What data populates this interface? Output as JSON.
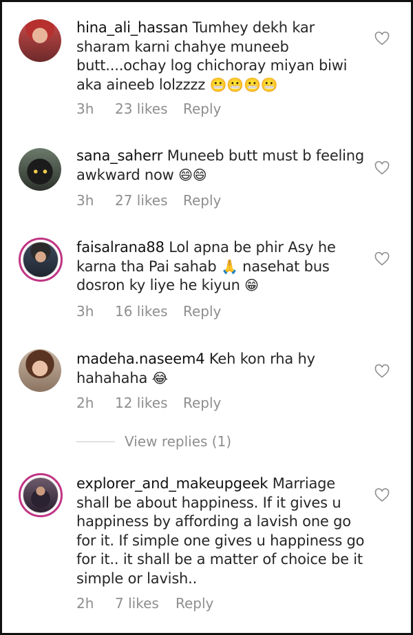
{
  "comments": [
    {
      "username": "hina_ali_hassan",
      "text": "Tumhey dekh kar sharam karni chahye muneeb butt....ochay log chichoray miyan biwi aka aineeb lolzzzz",
      "emoji": "😬😬😬😬",
      "time": "3h",
      "likes": "23 likes",
      "reply": "Reply"
    },
    {
      "username": "sana_saherr",
      "text": "Muneeb butt must b feeling awkward now",
      "emoji": "😄😄",
      "time": "3h",
      "likes": "27 likes",
      "reply": "Reply"
    },
    {
      "username": "faisalrana88",
      "text_a": "Lol apna be phir Asy he karna tha Pai sahab",
      "emoji_a": "🙏",
      "text_b": "nasehat bus dosron ky liye he kiyun",
      "emoji": "😁",
      "time": "3h",
      "likes": "16 likes",
      "reply": "Reply"
    },
    {
      "username": "madeha.naseem4",
      "text": "Keh kon rha hy hahahaha",
      "emoji": "😂",
      "time": "2h",
      "likes": "12 likes",
      "reply": "Reply"
    },
    {
      "username": "explorer_and_makeupgeek",
      "text": "Marriage shall be about happiness.  If it gives u happiness by affording a lavish one go for it. If simple one gives u happiness go for it.. it shall be a matter of choice be it simple or lavish..",
      "time": "2h",
      "likes": "7 likes",
      "reply": "Reply"
    }
  ],
  "view_replies": "View replies (1)",
  "icons": {
    "like": "heart-outline-icon"
  },
  "colors": {
    "meta": "#8e8e8e",
    "story_ring": "#c13584",
    "text": "#262626"
  }
}
